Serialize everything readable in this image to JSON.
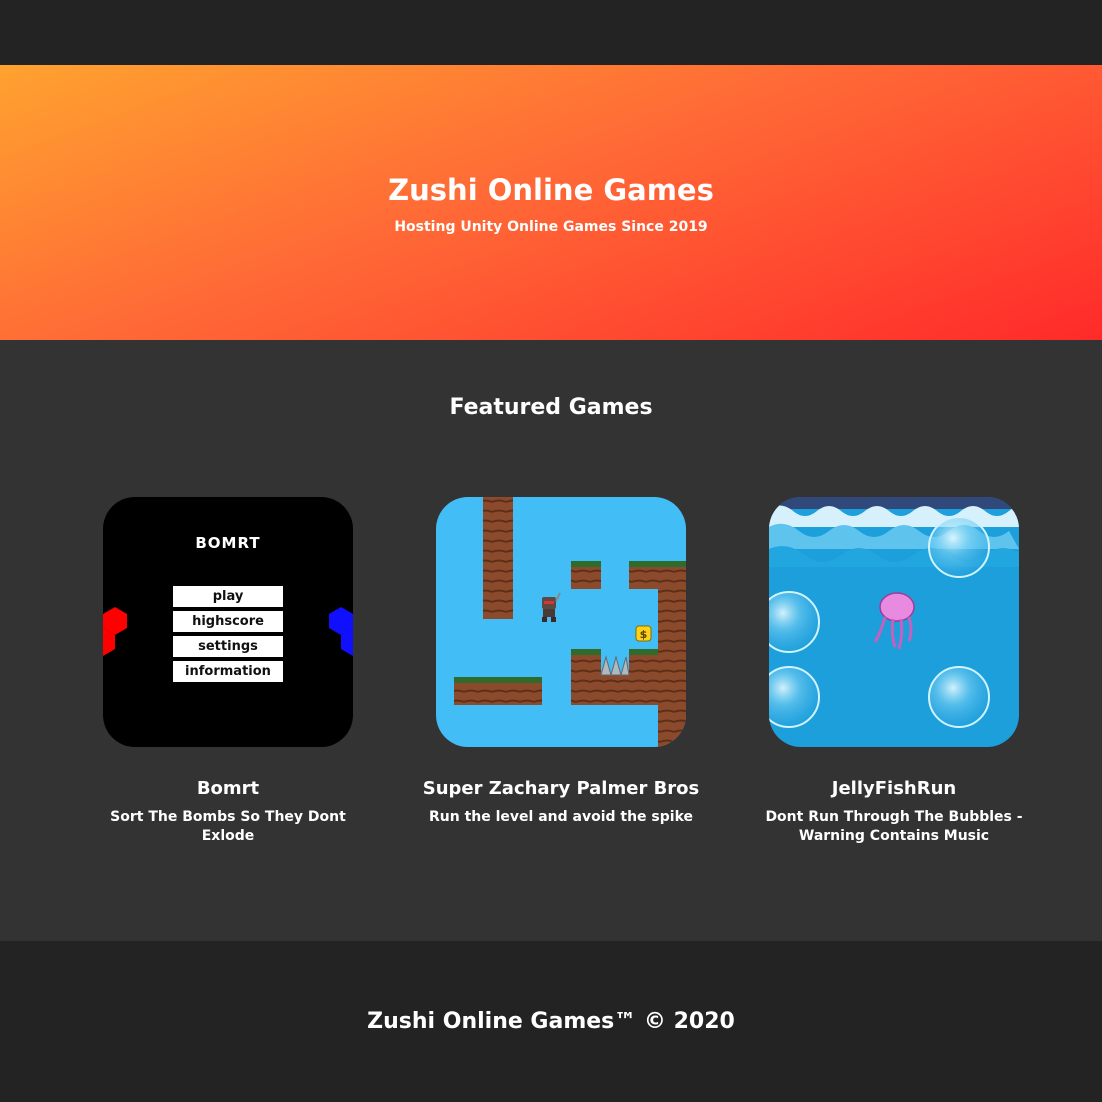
{
  "hero": {
    "title": "Zushi Online Games",
    "subtitle": "Hosting Unity Online Games Since 2019"
  },
  "featured": {
    "heading": "Featured Games",
    "games": [
      {
        "title": "Bomrt",
        "description": "Sort The Bombs So They Dont Exlode",
        "thumbnail": {
          "logo": "Bomrt",
          "menu": [
            "play",
            "highscore",
            "settings",
            "information"
          ]
        }
      },
      {
        "title": "Super Zachary Palmer Bros",
        "description": "Run the level and avoid the spike",
        "thumbnail": {
          "coin_symbol": "$"
        }
      },
      {
        "title": "JellyFishRun",
        "description": "Dont Run Through The Bubbles - Warning Contains Music",
        "thumbnail": {}
      }
    ]
  },
  "footer": {
    "text": "Zushi Online Games™ © 2020"
  },
  "colors": {
    "topbar": "#232323",
    "hero_gradient_start": "#ffa22f",
    "hero_gradient_end": "#ff2a2a",
    "section_bg": "#333333",
    "footer_bg": "#232323"
  }
}
